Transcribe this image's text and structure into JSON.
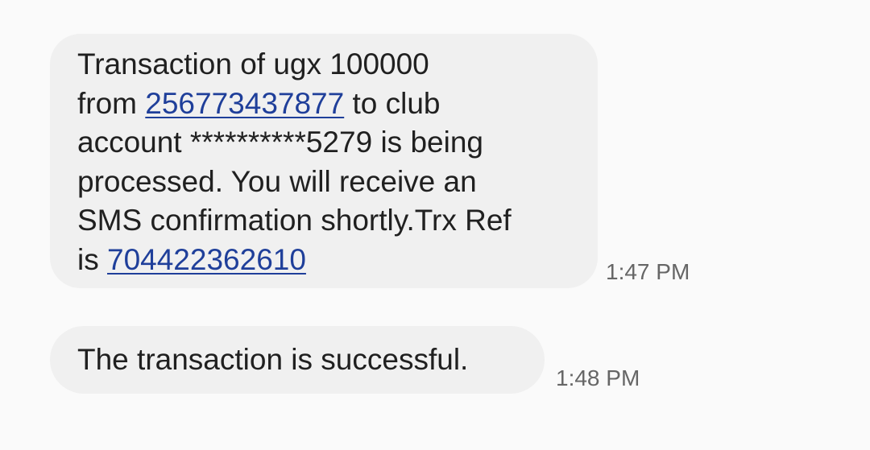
{
  "messages": [
    {
      "line1": "Transaction of ugx 100000",
      "line2_prefix": "from ",
      "phone_number": "256773437877",
      "line2_suffix": " to club",
      "line3": "account **********5279 is being",
      "line4": "processed. You will receive an",
      "line5": "SMS confirmation shortly.Trx Ref",
      "line6_prefix": "is ",
      "trx_ref": "704422362610",
      "time": "1:47 PM"
    },
    {
      "text": "The transaction is successful.",
      "time": "1:48 PM"
    }
  ],
  "colors": {
    "background": "#fafafa",
    "bubble": "#f0f0f0",
    "link": "#1f3f9a",
    "timestamp": "#666666"
  }
}
